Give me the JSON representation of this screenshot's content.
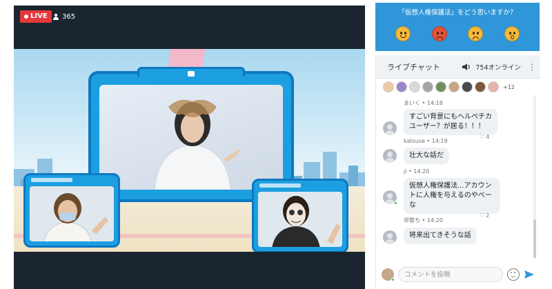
{
  "player": {
    "live_label": "LIVE",
    "viewer_count": "365"
  },
  "poll": {
    "question": "「仮想人権保護法」をどう思いますか？",
    "emojis": [
      "happy-emoji",
      "angry-emoji",
      "sad-emoji",
      "shocked-emoji"
    ]
  },
  "chat": {
    "title": "ライブチャット",
    "online": "754オンライン",
    "avatars_more": "+12",
    "messages": [
      {
        "author": "まいく",
        "time": "14:18",
        "text": "",
        "likes": ""
      },
      {
        "author": "",
        "time": "",
        "text": "すごい背景にもヘルペチカユーザー？が居る！！！",
        "likes": "4"
      },
      {
        "author": "katsuse",
        "time": "14:19",
        "text": "壮大な話だ",
        "likes": ""
      },
      {
        "author": "ji",
        "time": "14:20",
        "text": "仮想人権保護法...アカウントに人権を与えるのやべーな",
        "likes": "2"
      },
      {
        "author": "早黎ち",
        "time": "14:20",
        "text": "将来出てきそうな話",
        "likes": ""
      }
    ],
    "input_placeholder": "コメントを投稿"
  },
  "colors": {
    "live_red": "#e5383b",
    "poll_blue": "#2f96d9",
    "send_blue": "#2f96d9"
  }
}
